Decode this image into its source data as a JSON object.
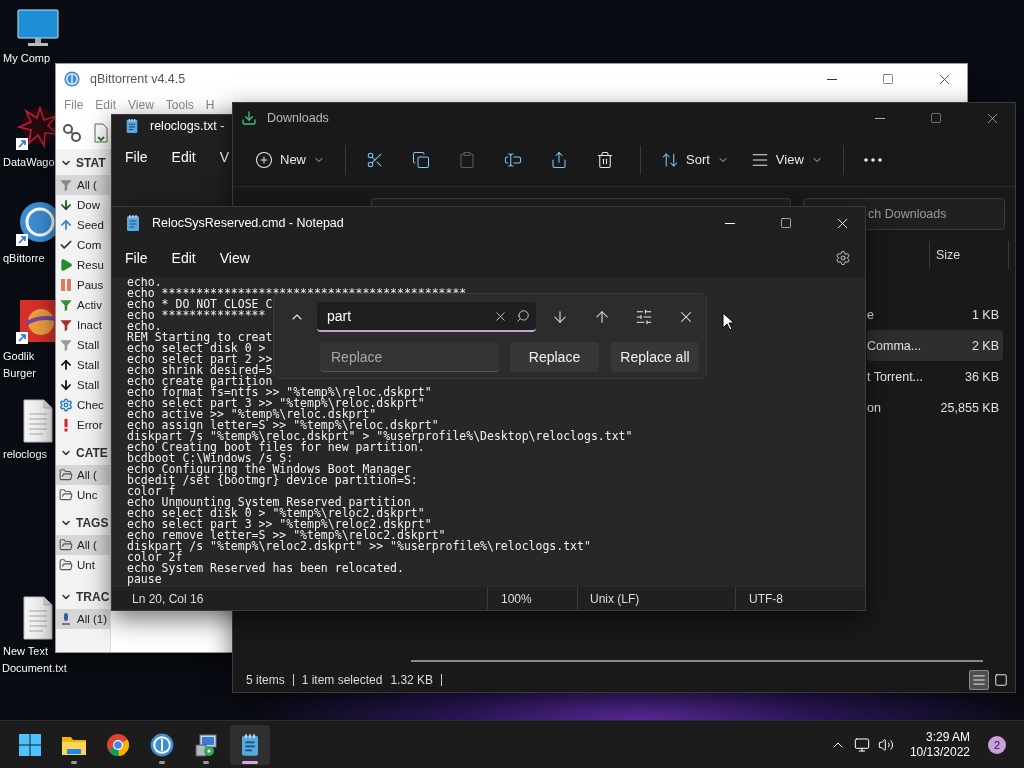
{
  "desktop_icons": [
    {
      "kind": "computer",
      "label": [
        "My Comp"
      ]
    },
    {
      "kind": "app",
      "label": [
        "DataWago"
      ]
    },
    {
      "kind": "torrent",
      "label": [
        "qBittorre"
      ]
    },
    {
      "kind": "game",
      "label": [
        "Godlik",
        "Burger"
      ]
    },
    {
      "kind": "document",
      "label": [
        "reloclogs"
      ]
    },
    {
      "kind": "document",
      "label": [
        "New Text",
        "Document.txt"
      ]
    }
  ],
  "qbittorrent": {
    "title": "qBittorrent v4.4.5",
    "menu": [
      "File",
      "Edit",
      "View",
      "Tools",
      "H"
    ],
    "sections": [
      {
        "title": "STAT",
        "items": [
          {
            "kind": "all",
            "label": "All (",
            "selected": true
          },
          {
            "kind": "downloading",
            "label": "Dow",
            "selected": false
          },
          {
            "kind": "seeding",
            "label": "Seed",
            "selected": false
          },
          {
            "kind": "completed",
            "label": "Com",
            "selected": false
          },
          {
            "kind": "resumed",
            "label": "Resu",
            "selected": false
          },
          {
            "kind": "paused",
            "label": "Paus",
            "selected": false
          },
          {
            "kind": "active",
            "label": "Activ",
            "selected": false
          },
          {
            "kind": "inactive",
            "label": "Inact",
            "selected": false
          },
          {
            "kind": "stalled",
            "label": "Stall",
            "selected": false
          },
          {
            "kind": "stalled-up",
            "label": "Stall",
            "selected": false
          },
          {
            "kind": "stalled-down",
            "label": "Stall",
            "selected": false
          },
          {
            "kind": "checking",
            "label": "Chec",
            "selected": false
          },
          {
            "kind": "errored",
            "label": "Error",
            "selected": false
          }
        ]
      },
      {
        "title": "CATE",
        "items": [
          {
            "kind": "folder",
            "label": "All (",
            "selected": true
          },
          {
            "kind": "folder",
            "label": "Unc",
            "selected": false
          }
        ]
      },
      {
        "title": "TAGS",
        "items": [
          {
            "kind": "folder",
            "label": "All (",
            "selected": true
          },
          {
            "kind": "folder",
            "label": "Unt",
            "selected": false
          }
        ]
      },
      {
        "title": "TRAC",
        "items": [
          {
            "kind": "tracker",
            "label": "All (1)",
            "selected": true
          }
        ]
      }
    ]
  },
  "reloclogs_window": {
    "title": "reloclogs.txt -",
    "menu": [
      "File",
      "Edit",
      "V"
    ]
  },
  "explorer": {
    "title": "Downloads",
    "toolbar": [
      {
        "kind": "new",
        "label": "New",
        "disabled": false
      },
      {
        "kind": "cut",
        "disabled": false
      },
      {
        "kind": "copy",
        "disabled": false
      },
      {
        "kind": "paste",
        "disabled": true
      },
      {
        "kind": "rename",
        "disabled": false
      },
      {
        "kind": "share",
        "disabled": false
      },
      {
        "kind": "delete",
        "disabled": false
      },
      {
        "kind": "sort",
        "label": "Sort",
        "disabled": false
      },
      {
        "kind": "view",
        "label": "View",
        "disabled": false
      },
      {
        "kind": "more",
        "disabled": false
      }
    ],
    "search": {
      "placeholder": "ch Downloads"
    },
    "columns": [
      "Size"
    ],
    "rows": [
      {
        "name": "e",
        "size": "1 KB",
        "selected": false
      },
      {
        "name": "Comma...",
        "size": "2 KB",
        "selected": true
      },
      {
        "name": "t Torrent...",
        "size": "36 KB",
        "selected": false
      },
      {
        "name": "on",
        "size": "25,855 KB",
        "selected": false
      }
    ],
    "status": [
      "5 items",
      "1 item selected",
      "1.32 KB"
    ],
    "views": [
      {
        "kind": "details",
        "selected": true
      },
      {
        "kind": "tiles",
        "selected": false
      }
    ]
  },
  "notepad": {
    "title": "RelocSysReserved.cmd - Notepad",
    "menu": [
      "File",
      "Edit",
      "View"
    ],
    "lines": [
      "echo.",
      "echo ********************************************",
      "echo * DO NOT CLOSE C",
      "echo ***************",
      "echo.",
      "REM Starting to creat",
      "echo select disk 0 >",
      "echo select part 2 >>",
      "echo shrink desired=5",
      "echo create partition",
      "echo format fs=ntfs >> \"%temp%\\reloc.dskprt\"",
      "echo select part 3 >> \"%temp%\\reloc.dskprt\"",
      "echo active >> \"%temp%\\reloc.dskprt\"",
      "echo assign letter=S >> \"%temp%\\reloc.dskprt\"",
      "diskpart /s \"%temp%\\reloc.dskprt\" > \"%userprofile%\\Desktop\\reloclogs.txt\"",
      "echo Creating boot files for new partition.",
      "bcdboot C:\\Windows /s S:",
      "echo Configuring the Windows Boot Manager",
      "bcdedit /set {bootmgr} device partition=S:",
      "color f",
      "echo Unmounting System Reserved partition",
      "echo select disk 0 > \"%temp%\\reloc2.dskprt\"",
      "echo select part 3 >> \"%temp%\\reloc2.dskprt\"",
      "echo remove letter=S >> \"%temp%\\reloc2.dskprt\"",
      "diskpart /s \"%temp%\\reloc2.dskprt\" >> \"%userprofile%\\reloclogs.txt\"",
      "color 2f",
      "echo System Reserved has been relocated.",
      "pause"
    ],
    "find": {
      "query": "part",
      "replace": {
        "placeholder": "Replace"
      },
      "buttons": [
        "Replace",
        "Replace all"
      ]
    },
    "status": [
      "Ln 20, Col 16",
      "100%",
      "Unix (LF)",
      "UTF-8"
    ]
  },
  "taskbar": {
    "apps": [
      {
        "kind": "start",
        "running": false,
        "selected": false
      },
      {
        "kind": "explorer",
        "running": true,
        "selected": false
      },
      {
        "kind": "browser",
        "running": false,
        "selected": false
      },
      {
        "kind": "torrent",
        "running": true,
        "selected": false
      },
      {
        "kind": "tool",
        "running": true,
        "selected": false
      },
      {
        "kind": "notepad",
        "running": true,
        "selected": true
      }
    ],
    "time": "3:29 AM",
    "date": "10/13/2022",
    "notifications": "2"
  }
}
